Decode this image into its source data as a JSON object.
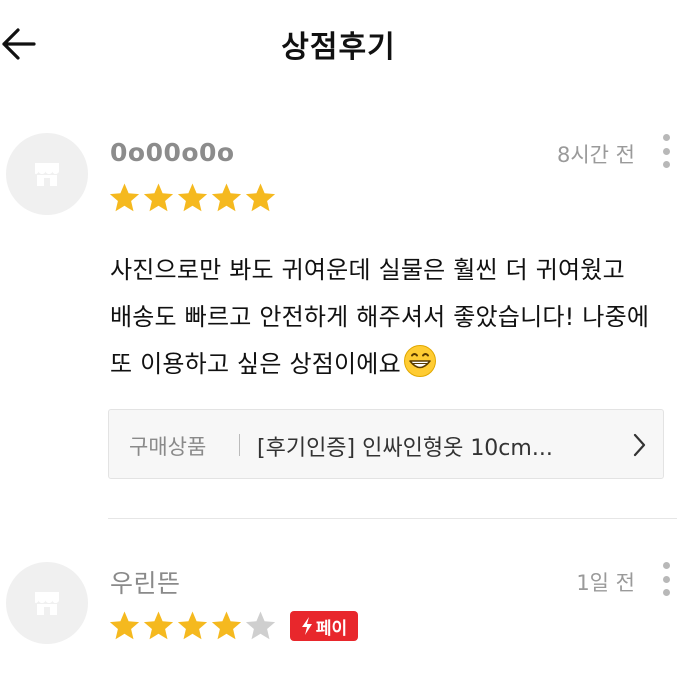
{
  "header": {
    "title": "상점후기"
  },
  "reviews": [
    {
      "username": "0o00o0o",
      "timestamp": "8시간 전",
      "rating": 5,
      "max_rating": 5,
      "text": "사진으로만 봐도 귀여운데 실물은 훨씬 더 귀여웠고 배송도 빠르고 안전하게 해주셔서 좋았습니다! 나중에 또 이용하고 싶은 상점이에요",
      "product": {
        "label": "구매상품",
        "name": "[후기인증] 인싸인형옷 10cm..."
      }
    },
    {
      "username": "우린뜬",
      "timestamp": "1일 전",
      "rating": 4,
      "max_rating": 5,
      "badge": "페이"
    }
  ],
  "colors": {
    "star": "#f5b91f",
    "star_empty": "#cfcfcf",
    "pay_badge": "#e8272c"
  },
  "icons": {
    "back": "arrow-left-icon",
    "avatar": "shop-icon",
    "more": "kebab-menu-icon",
    "product": "chevron-right-icon",
    "emoji": "grinning-face-emoji"
  }
}
